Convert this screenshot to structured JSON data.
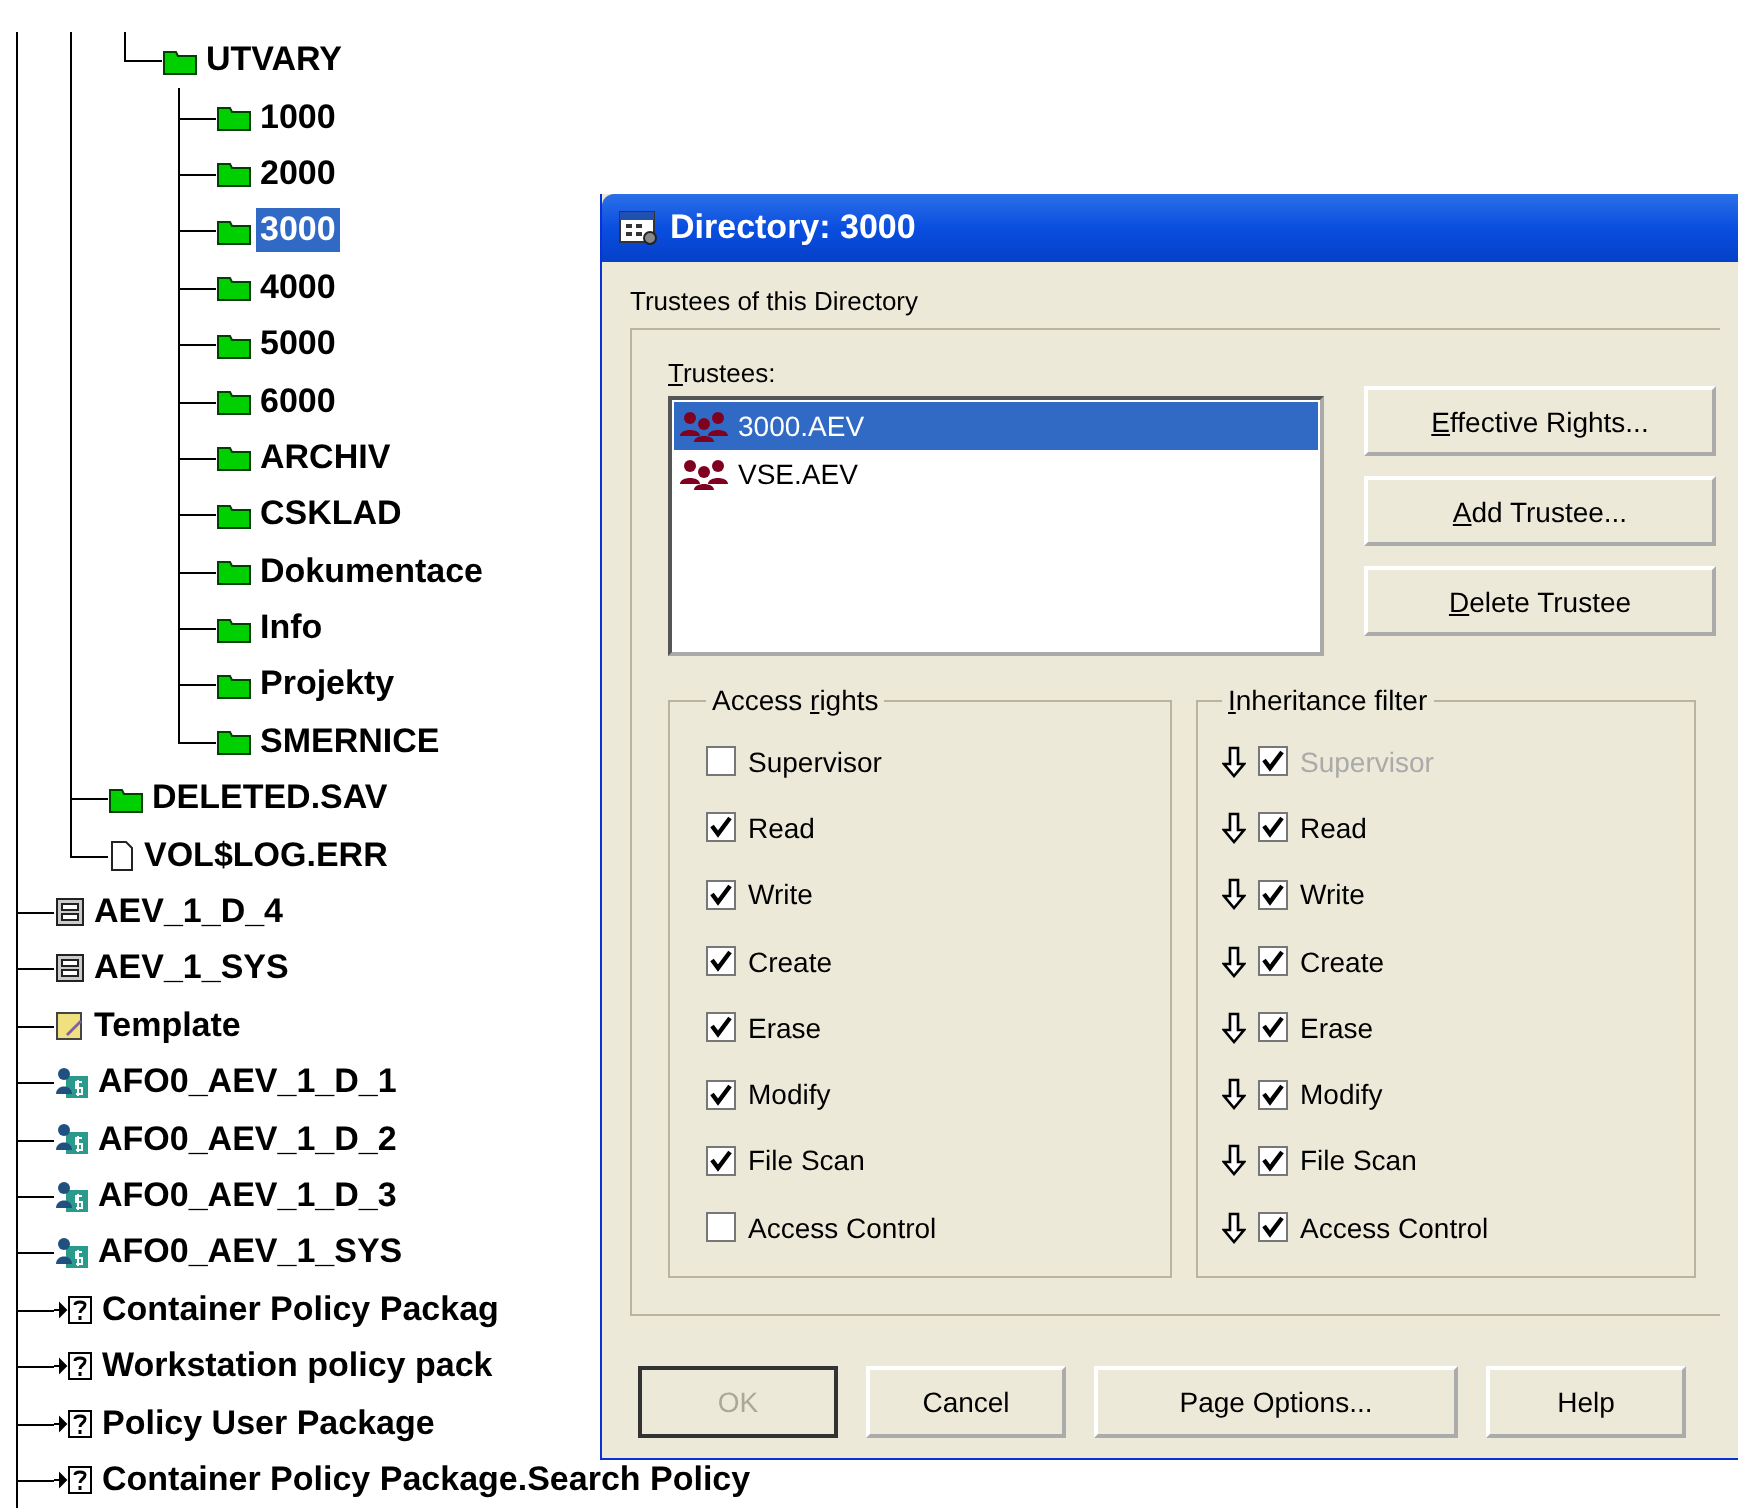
{
  "tree": {
    "more_below": true,
    "items": [
      {
        "children": [
          {
            "children": [
              {
                "label": "UTVARY",
                "kind": "folder",
                "selected": false,
                "children": [
                  {
                    "label": "1000",
                    "kind": "folder",
                    "selected": false
                  },
                  {
                    "label": "2000",
                    "kind": "folder",
                    "selected": false
                  },
                  {
                    "label": "3000",
                    "kind": "folder",
                    "selected": true
                  },
                  {
                    "label": "4000",
                    "kind": "folder",
                    "selected": false
                  },
                  {
                    "label": "5000",
                    "kind": "folder",
                    "selected": false
                  },
                  {
                    "label": "6000",
                    "kind": "folder",
                    "selected": false
                  },
                  {
                    "label": "ARCHIV",
                    "kind": "folder",
                    "selected": false
                  },
                  {
                    "label": "CSKLAD",
                    "kind": "folder",
                    "selected": false
                  },
                  {
                    "label": "Dokumentace",
                    "kind": "folder",
                    "selected": false
                  },
                  {
                    "label": "Info",
                    "kind": "folder",
                    "selected": false
                  },
                  {
                    "label": "Projekty",
                    "kind": "folder",
                    "selected": false
                  },
                  {
                    "label": "SMERNICE",
                    "kind": "folder",
                    "selected": false
                  }
                ]
              }
            ]
          },
          {
            "label": "DELETED.SAV",
            "kind": "folder",
            "selected": false
          },
          {
            "label": "VOL$LOG.ERR",
            "kind": "file",
            "selected": false
          }
        ]
      },
      {
        "label": "AEV_1_D_4",
        "kind": "volume",
        "selected": false
      },
      {
        "label": "AEV_1_SYS",
        "kind": "volume",
        "selected": false
      },
      {
        "label": "Template",
        "kind": "template",
        "selected": false
      },
      {
        "label": "AFO0_AEV_1_D_1",
        "kind": "user",
        "selected": false
      },
      {
        "label": "AFO0_AEV_1_D_2",
        "kind": "user",
        "selected": false
      },
      {
        "label": "AFO0_AEV_1_D_3",
        "kind": "user",
        "selected": false
      },
      {
        "label": "AFO0_AEV_1_SYS",
        "kind": "user",
        "selected": false
      },
      {
        "label": "Container Policy Packag",
        "kind": "policy",
        "selected": false
      },
      {
        "label": "Workstation policy pack",
        "kind": "policy",
        "selected": false
      },
      {
        "label": "Policy User Package",
        "kind": "policy",
        "selected": false
      },
      {
        "label": "Container Policy Package.Search Policy",
        "kind": "policy",
        "selected": false
      }
    ]
  },
  "dialog": {
    "title": "Directory: 3000",
    "tab": "Trustees of this Directory",
    "trustees_label": {
      "key": "T",
      "after": "rustees:"
    },
    "trustees": [
      {
        "name": "3000.AEV",
        "selected": true
      },
      {
        "name": "VSE.AEV",
        "selected": false
      }
    ],
    "side_buttons": [
      {
        "key": "E",
        "after": "ffective Rights..."
      },
      {
        "key": "A",
        "after": "dd Trustee..."
      },
      {
        "key": "D",
        "after": "elete Trustee"
      }
    ],
    "access_rights": {
      "title": {
        "before": "Access ",
        "key": "r",
        "after": "ights"
      },
      "items": [
        {
          "label": "Supervisor",
          "checked": false
        },
        {
          "label": "Read",
          "checked": true
        },
        {
          "label": "Write",
          "checked": true
        },
        {
          "label": "Create",
          "checked": true
        },
        {
          "label": "Erase",
          "checked": true
        },
        {
          "label": "Modify",
          "checked": true
        },
        {
          "label": "File Scan",
          "checked": true
        },
        {
          "label": "Access Control",
          "checked": false
        }
      ]
    },
    "inheritance_filter": {
      "title": {
        "key": "I",
        "after": "nheritance filter"
      },
      "items": [
        {
          "label": "Supervisor",
          "checked": true,
          "disabled": true
        },
        {
          "label": "Read",
          "checked": true,
          "disabled": false
        },
        {
          "label": "Write",
          "checked": true,
          "disabled": false
        },
        {
          "label": "Create",
          "checked": true,
          "disabled": false
        },
        {
          "label": "Erase",
          "checked": true,
          "disabled": false
        },
        {
          "label": "Modify",
          "checked": true,
          "disabled": false
        },
        {
          "label": "File Scan",
          "checked": true,
          "disabled": false
        },
        {
          "label": "Access Control",
          "checked": true,
          "disabled": false
        }
      ]
    },
    "buttons": [
      {
        "label": "OK",
        "disabled": true
      },
      {
        "label": "Cancel",
        "disabled": false
      },
      {
        "label": "Page Options...",
        "disabled": false
      },
      {
        "label": "Help",
        "disabled": false
      }
    ]
  }
}
